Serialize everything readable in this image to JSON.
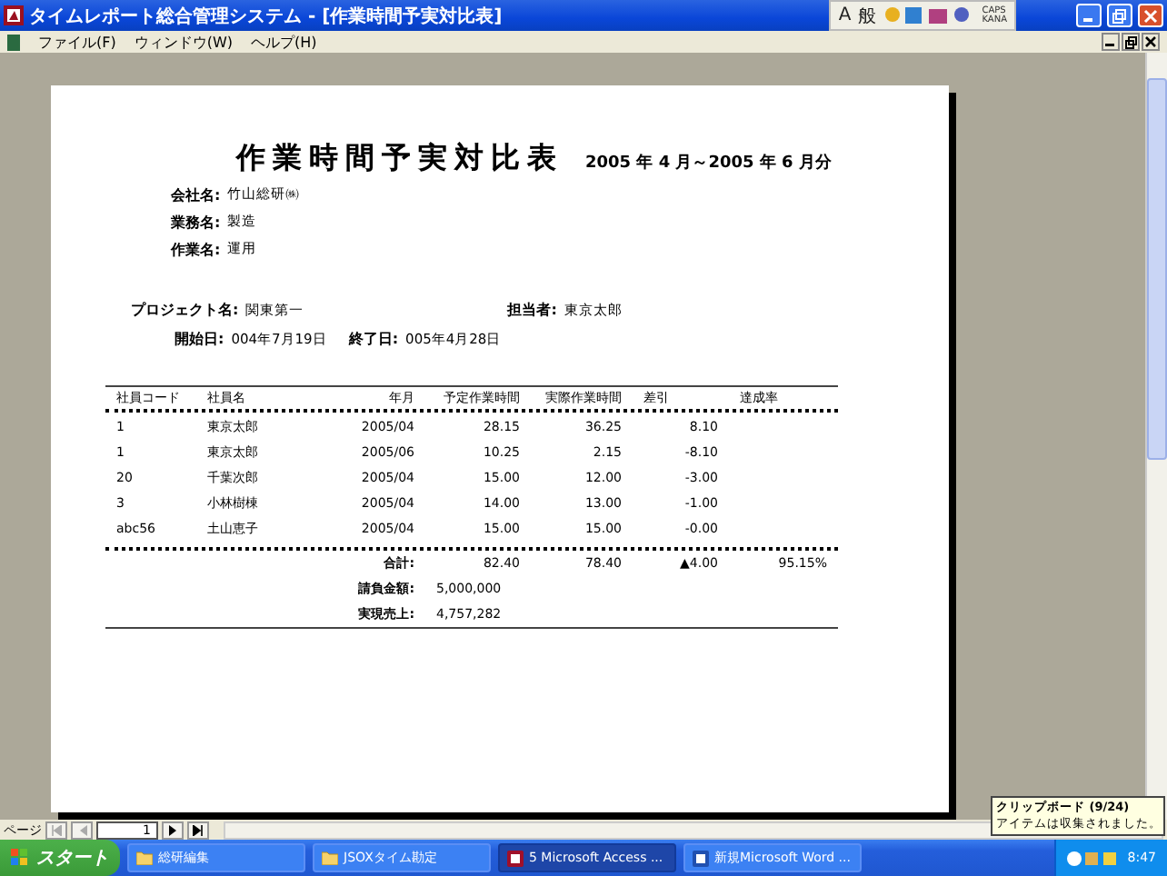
{
  "window": {
    "title": "タイムレポート総合管理システム - [作業時間予実対比表]"
  },
  "ime_bar": {
    "mode": "A",
    "dictionary": "般",
    "caps": "CAPS",
    "kana": "KANA"
  },
  "menu": [
    "ファイル(F)",
    "ウィンドウ(W)",
    "ヘルプ(H)"
  ],
  "report": {
    "title": "作業時間予実対比表",
    "period": "2005 年  4 月～2005 年  6 月分",
    "info": [
      {
        "label": "会社名:",
        "value": "竹山総研㈱"
      },
      {
        "label": "業務名:",
        "value": "製造"
      },
      {
        "label": "作業名:",
        "value": "運用"
      }
    ],
    "project": {
      "label": "プロジェクト名:",
      "value": "関東第一",
      "owner_label": "担当者:",
      "owner": "東京太郎"
    },
    "dates": {
      "start_label": "開始日:",
      "start": "004年7月19日",
      "end_label": "終了日:",
      "end": "005年4月28日"
    },
    "columns": [
      "社員コード",
      "社員名",
      "年月",
      "予定作業時間",
      "実際作業時間",
      "差引",
      "達成率"
    ],
    "rows": [
      [
        "1",
        "東京太郎",
        "2005/04",
        "28.15",
        "36.25",
        "8.10"
      ],
      [
        "1",
        "東京太郎",
        "2005/06",
        "10.25",
        "2.15",
        "-8.10"
      ],
      [
        "20",
        "千葉次郎",
        "2005/04",
        "15.00",
        "12.00",
        "-3.00"
      ],
      [
        "3",
        "小林樹棟",
        "2005/04",
        "14.00",
        "13.00",
        "-1.00"
      ],
      [
        "abc56",
        "土山恵子",
        "2005/04",
        "15.00",
        "15.00",
        "-0.00"
      ]
    ],
    "totals": {
      "label": "合計:",
      "planned": "82.40",
      "actual": "78.40",
      "diff": "▲4.00",
      "rate": "95.15%"
    },
    "amounts": [
      {
        "label": "請負金額:",
        "value": "5,000,000"
      },
      {
        "label": "実現売上:",
        "value": "4,757,282"
      }
    ]
  },
  "navigator": {
    "label": "ページ",
    "page": "1"
  },
  "clipboard": {
    "title": "クリップボード (9/24)",
    "message": "アイテムは収集されました。"
  },
  "taskbar": {
    "start": "スタート",
    "tasks": [
      {
        "label": "総研編集",
        "selected": false,
        "kind": "folder"
      },
      {
        "label": "JSOXタイム勘定",
        "selected": false,
        "kind": "folder"
      },
      {
        "label": "5 Microsoft Access ...",
        "selected": true,
        "kind": "access"
      },
      {
        "label": "新規Microsoft Word ...",
        "selected": false,
        "kind": "word"
      }
    ],
    "clock": "8:47"
  }
}
